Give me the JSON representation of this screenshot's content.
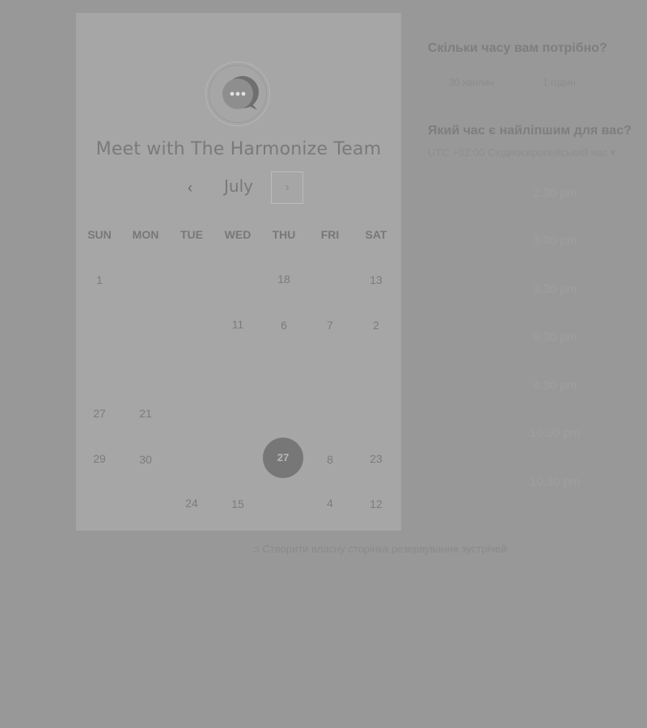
{
  "meeting": {
    "title": "Meet with The Harmonize Team"
  },
  "calendar": {
    "month": "July",
    "prev_icon": "chevron-left-icon",
    "next_icon": "chevron-right-icon",
    "weekdays": [
      "SUN",
      "MON",
      "TUE",
      "WED",
      "THU",
      "FRI",
      "SAT"
    ],
    "days": [
      "1",
      "18",
      "13",
      "11",
      "6",
      "7",
      "2",
      "27",
      "21",
      "29",
      "30",
      "27",
      "8",
      "23",
      "24",
      "15",
      "4",
      "12"
    ],
    "selected_day": "27"
  },
  "duration": {
    "question": "Скільки часу вам потрібно?",
    "options": [
      "30 хвилин",
      "1 годин"
    ]
  },
  "time": {
    "question": "Який час є найліпшим для вас?",
    "timezone": "UTC +02:00 Східноєвропейський час",
    "slots": [
      "2:30 pm",
      "3:00 pm",
      "3:30 pm",
      "9:30 pm",
      "4:30 pm",
      "10:00 pm",
      "10:30 pm"
    ]
  },
  "footer": {
    "link_text": "Створити власну сторінка резервування зустрічей",
    "icon": "hubspot-sprocket-icon"
  },
  "colors": {
    "background": "#989898",
    "card": "#a6a6a6",
    "selected": "#777777"
  }
}
